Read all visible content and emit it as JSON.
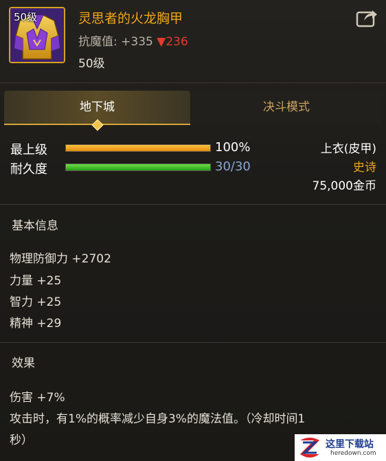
{
  "item": {
    "level_badge": "50级",
    "name": "灵思者的火龙胸甲",
    "stat_label": "抗魔值:",
    "stat_value": "+335",
    "stat_diff": "▼236",
    "level_text": "50级"
  },
  "tabs": [
    {
      "label": "地下城"
    },
    {
      "label": "决斗模式"
    }
  ],
  "bars": {
    "upgrade": {
      "label": "最上级",
      "value": "100%",
      "fill": 1.0
    },
    "durability": {
      "label": "耐久度",
      "value": "30/30",
      "fill": 1.0
    }
  },
  "info": {
    "slot": "上衣(皮甲)",
    "rarity": "史诗",
    "price": "75,000金币"
  },
  "basic": {
    "title": "基本信息",
    "lines": [
      "物理防御力 +2702",
      "力量 +25",
      "智力 +25",
      "精神 +29"
    ]
  },
  "effects": {
    "title": "效果",
    "lines": [
      "伤害 +7%",
      "攻击时，有1%的概率减少自身3%的魔法值。（冷却时间1",
      "秒）"
    ]
  },
  "watermark": {
    "title": "这里下载站",
    "url": "heredown.com"
  },
  "colors": {
    "item_name": "#f0a51d",
    "rarity": "#f0a51d",
    "stat_decrease": "#e33a2c"
  }
}
